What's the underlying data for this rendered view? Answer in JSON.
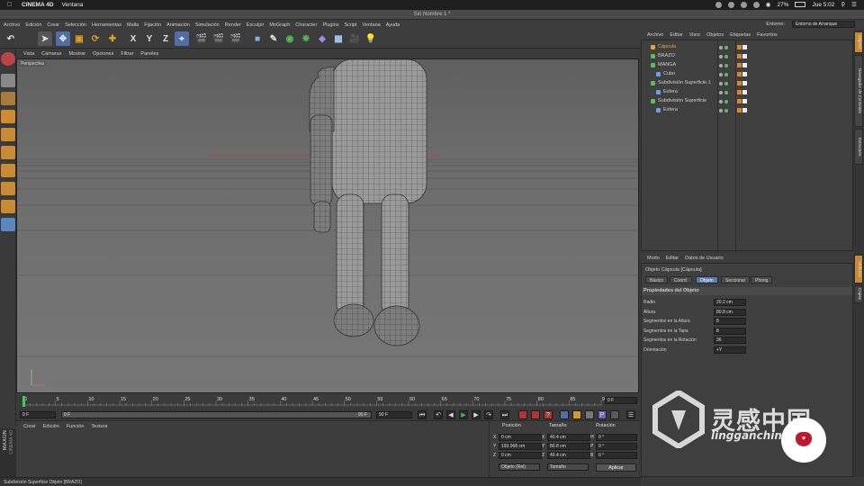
{
  "macbar": {
    "app": "CINEMA 4D",
    "menu": [
      "Ventana"
    ],
    "battery": "27%",
    "time": "Jue 5:02"
  },
  "window": {
    "title": "Sin Nombre 1 *"
  },
  "c4d_menu": [
    "Archivo",
    "Edición",
    "Crear",
    "Selección",
    "Herramientas",
    "Malla",
    "Fijación",
    "Animación",
    "Simulación",
    "Render",
    "Esculpir",
    "MoGraph",
    "Character",
    "Plugins",
    "Script",
    "Ventana",
    "Ayuda"
  ],
  "layout": {
    "label": "Entorno:",
    "value": "Entorno de Arranque"
  },
  "toolbar": {
    "axis_x": "X",
    "axis_y": "Y",
    "axis_z": "Z"
  },
  "viewport": {
    "menu": [
      "Vista",
      "Cámaras",
      "Mostrar",
      "Opciones",
      "Filtrar",
      "Paneles"
    ],
    "label": "Perspectiva"
  },
  "timeline": {
    "ticks": [
      "0",
      "5",
      "10",
      "15",
      "20",
      "25",
      "30",
      "35",
      "40",
      "45",
      "50",
      "55",
      "60",
      "65",
      "70",
      "75",
      "80",
      "85",
      "90"
    ],
    "current_frame": "0 F",
    "start_frame": "0 F",
    "min_field": "0 F",
    "max_field": "90 F",
    "end_frame": "90 F"
  },
  "material": {
    "menu": [
      "Crear",
      "Edición",
      "Función",
      "Textura"
    ]
  },
  "coords": {
    "headers": [
      "Posición",
      "Tamaño",
      "Rotación"
    ],
    "pos": {
      "x": "0 cm",
      "y": "193.968 cm",
      "z": "0 cm"
    },
    "size": {
      "x": "40.4 cm",
      "y": "80.8 cm",
      "z": "40.4 cm"
    },
    "rot": {
      "h": "0 °",
      "p": "0 °",
      "b": "0 °"
    },
    "axis_labels": {
      "x": "X",
      "y": "Y",
      "z": "Z",
      "h": "H",
      "p": "P",
      "b": "B"
    },
    "mode": "Objeto (Rel)",
    "size_mode": "Tamaño",
    "apply": "Aplicar"
  },
  "status": "Subdivisión Superficie Objeto [BRAZO]",
  "object_manager": {
    "menu": [
      "Archivo",
      "Editar",
      "Visor",
      "Objetos",
      "Etiquetas",
      "Favoritos"
    ],
    "objects": [
      {
        "name": "Cápsula",
        "indent": 0,
        "color": "#e8a23a",
        "selected": true
      },
      {
        "name": "BRAZO",
        "indent": 0,
        "color": "#5fba5f"
      },
      {
        "name": "MANGA",
        "indent": 0,
        "color": "#5fba5f"
      },
      {
        "name": "Cubo",
        "indent": 1,
        "color": "#6aa0e8"
      },
      {
        "name": "Subdivisión Superficie.1",
        "indent": 0,
        "color": "#5fba5f"
      },
      {
        "name": "Esfera",
        "indent": 1,
        "color": "#6aa0e8"
      },
      {
        "name": "Subdivisión Superficie",
        "indent": 0,
        "color": "#5fba5f"
      },
      {
        "name": "Esfera",
        "indent": 1,
        "color": "#6aa0e8"
      }
    ]
  },
  "attributes": {
    "menu": [
      "Modo",
      "Editar",
      "Datos de Usuario"
    ],
    "title": "Objeto Cápsula [Cápsula]",
    "tabs": [
      "Básico",
      "Coord.",
      "Objeto",
      "Seccionar",
      "Phong"
    ],
    "selected_tab": "Objeto",
    "section": "Propiedades del Objeto",
    "props": [
      {
        "label": "Radio",
        "value": "20.2 cm"
      },
      {
        "label": "Altura",
        "value": "80.8 cm"
      },
      {
        "label": "Segmentos en la Altura",
        "value": "8"
      },
      {
        "label": "Segmentos en la Tapa",
        "value": "8"
      },
      {
        "label": "Segmentos en la Rotación",
        "value": "36"
      },
      {
        "label": "Orientación",
        "value": "+Y"
      }
    ]
  },
  "right_tabs": [
    "Objetos",
    "Navegador de Contenido",
    "Estructura",
    "Atributos",
    "Capas"
  ],
  "branding": {
    "maxon": "MAXON",
    "c4d": "CINEMA 4D"
  },
  "watermark": {
    "text": "灵感中国",
    "url": "lingganchina.com"
  },
  "colors": {
    "accent_blue": "#5a7ab0",
    "object_orange": "#e8a23a",
    "object_green": "#5fba5f"
  }
}
